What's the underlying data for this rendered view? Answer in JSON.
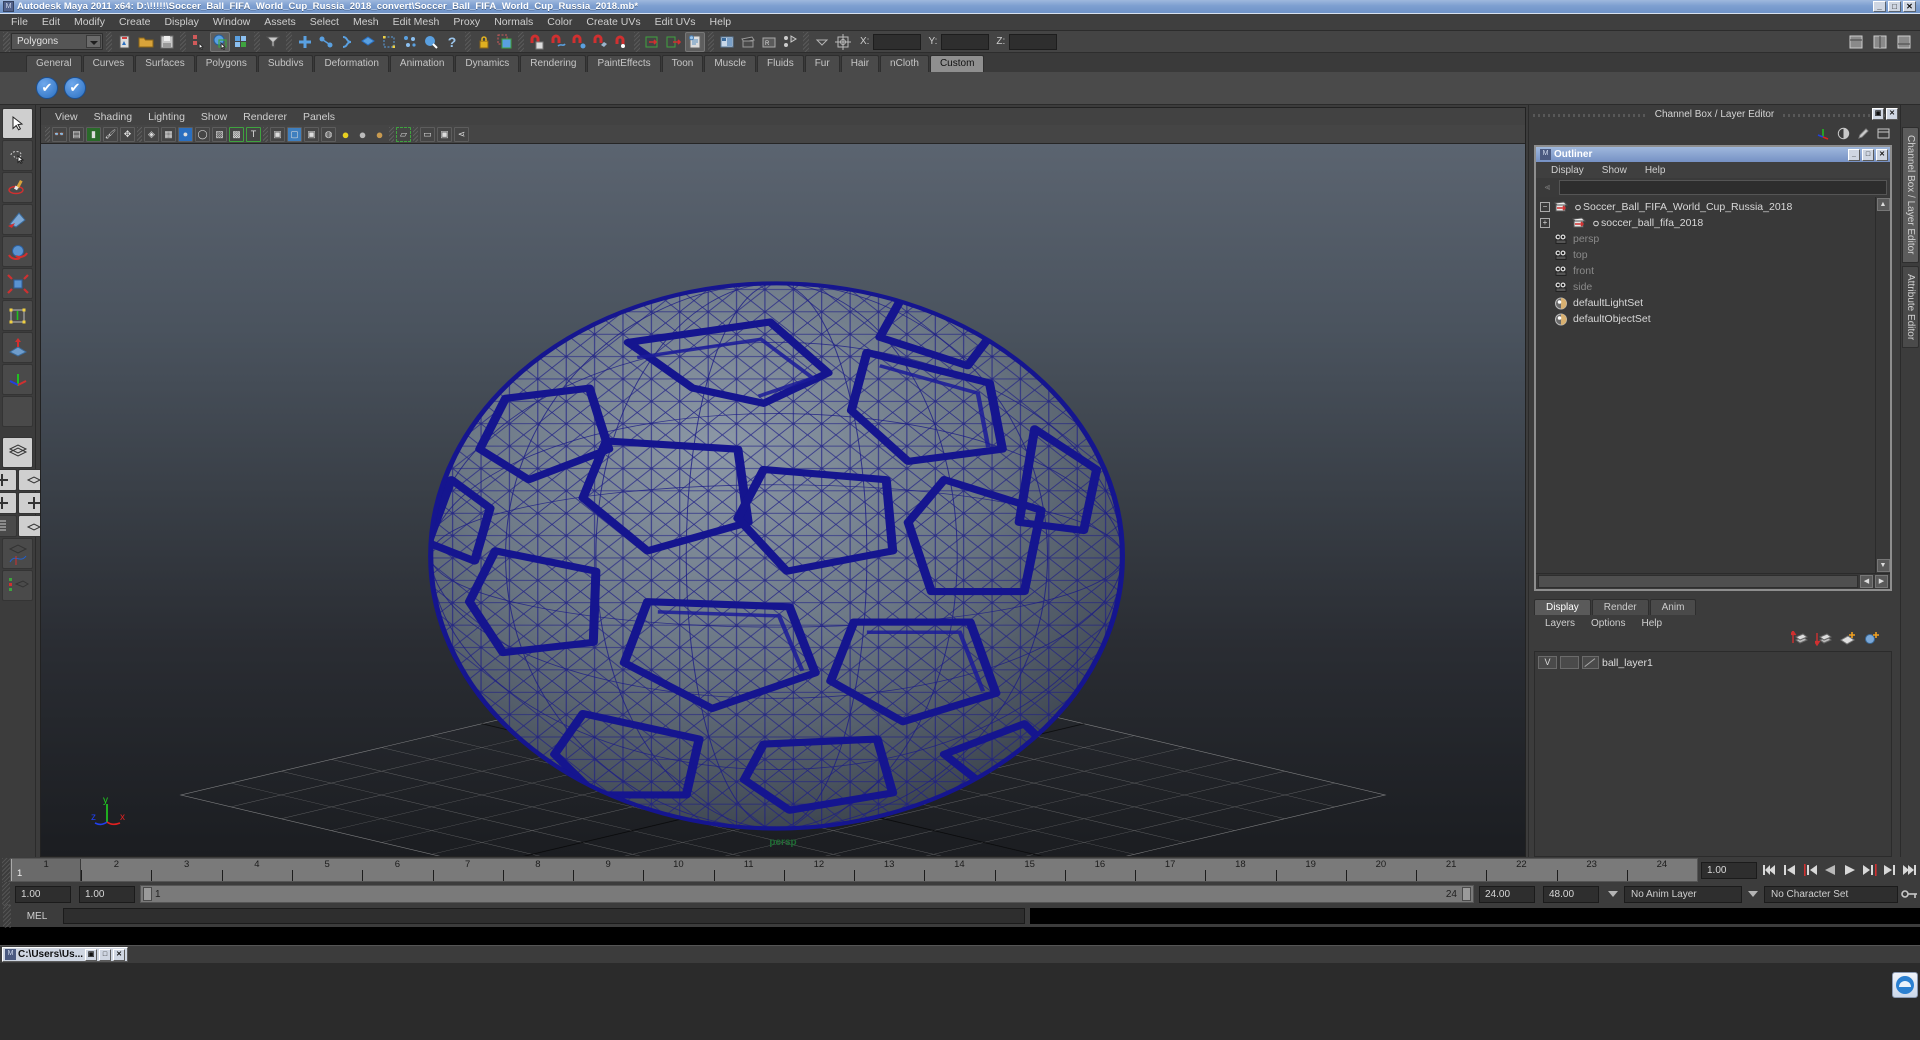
{
  "window": {
    "title": "Autodesk Maya 2011 x64: D:\\!!!!!\\Soccer_Ball_FIFA_World_Cup_Russia_2018_convert\\Soccer_Ball_FIFA_World_Cup_Russia_2018.mb*",
    "app_icon": "maya-icon",
    "minimize": "_",
    "maximize": "□",
    "close": "✕",
    "accent_titlebar": "#7d9fd0"
  },
  "menubar": {
    "items": [
      "File",
      "Edit",
      "Modify",
      "Create",
      "Display",
      "Window",
      "Assets",
      "Select",
      "Mesh",
      "Edit Mesh",
      "Proxy",
      "Normals",
      "Color",
      "Create UVs",
      "Edit UVs",
      "Help"
    ]
  },
  "toolbar": {
    "mode_selector": "Polygons",
    "coords": {
      "x_label": "X:",
      "y_label": "Y:",
      "z_label": "Z:",
      "x_value": "",
      "y_value": "",
      "z_value": ""
    },
    "icons": [
      "new-scene-icon",
      "open-scene-icon",
      "save-scene-icon",
      "select-by-hierarchy-icon",
      "select-by-object-icon",
      "select-by-component-icon",
      "selection-mask-icon",
      "snap-grid-icon",
      "snap-curve-icon",
      "snap-point-icon",
      "snap-view-plane-icon",
      "snap-live-icon",
      "magnet-grid-icon",
      "magnet-curve-icon",
      "magnet-point-icon",
      "magnet-plane-icon",
      "magnet-live-icon",
      "render-current-frame-icon",
      "ipr-render-icon",
      "render-settings-icon",
      "hypershade-icon",
      "render-view-icon",
      "render-globals-icon",
      "hypergraph-icon",
      "lock-icon",
      "highlight-selection-icon",
      "show-manipulator-icon"
    ]
  },
  "shelf": {
    "tabs": [
      "General",
      "Curves",
      "Surfaces",
      "Polygons",
      "Subdivs",
      "Deformation",
      "Animation",
      "Dynamics",
      "Rendering",
      "PaintEffects",
      "Toon",
      "Muscle",
      "Fluids",
      "Fur",
      "Hair",
      "nCloth",
      "Custom"
    ],
    "active_tab": "Custom",
    "buttons": [
      "check-button-1",
      "check-button-2"
    ]
  },
  "toolbox": {
    "tools": [
      {
        "name": "select-tool",
        "glyph": "➤",
        "selected": true
      },
      {
        "name": "lasso-select-tool",
        "glyph": "◌"
      },
      {
        "name": "paint-select-tool",
        "glyph": "🖌"
      },
      {
        "name": "move-tool",
        "glyph": "◤"
      },
      {
        "name": "rotate-tool",
        "glyph": "◍"
      },
      {
        "name": "scale-tool",
        "glyph": "✥"
      },
      {
        "name": "universal-manipulator-tool",
        "glyph": "▣"
      },
      {
        "name": "soft-modification-tool",
        "glyph": "▲"
      },
      {
        "name": "show-manipulator-tool",
        "glyph": "✛"
      },
      {
        "name": "last-tool-used",
        "glyph": ""
      }
    ],
    "layouts": [
      "single-perspective-view",
      "four-view-layout",
      "persp-outliner-layout",
      "persp-graph-editor-layout",
      "persp-hypershade-layout"
    ]
  },
  "viewport": {
    "menus": [
      "View",
      "Shading",
      "Lighting",
      "Show",
      "Renderer",
      "Panels"
    ],
    "camera_label": "persp",
    "axis": {
      "x": "x",
      "y": "y",
      "z": "z",
      "x_color": "#e02020",
      "y_color": "#20d020",
      "z_color": "#2040f0"
    },
    "wireframe_color": "#1f1f8f",
    "shaded_color": "#68737f",
    "toolbar_icons": [
      "select-camera-icon",
      "camera-attributes-icon",
      "image-plane-icon",
      "paint-effects-icon",
      "2d-pan-zoom-icon",
      "wireframe-icon",
      "smooth-shade-icon",
      "hardware-texture-icon",
      "use-default-lighting-icon",
      "xray-icon",
      "xray-joints-icon",
      "show-textures-icon",
      "grid-toggle-icon",
      "film-gate-icon",
      "resolution-gate-icon",
      "gate-mask-icon",
      "light-icon-yellow",
      "light-icon-grey",
      "light-icon-tan",
      "selection-highlight-icon",
      "isolate-select-icon",
      "single-pane-icon",
      "multi-pane-icon",
      "share-icon"
    ]
  },
  "channel_box_header": {
    "title": "Channel Box / Layer Editor",
    "icons": [
      "axis-icon",
      "contrast-icon",
      "pencil-icon",
      "attributes-icon"
    ],
    "window_buttons": [
      "restore",
      "close"
    ]
  },
  "outliner": {
    "title": "Outliner",
    "icon": "maya-icon",
    "window_buttons": [
      "_",
      "□",
      "✕"
    ],
    "menus": [
      "Display",
      "Show",
      "Help"
    ],
    "search_value": "",
    "search_placeholder": "",
    "rows": [
      {
        "label": "Soccer_Ball_FIFA_World_Cup_Russia_2018",
        "icon": "transform-node-icon",
        "expander": "−",
        "indent": 0,
        "dim": false
      },
      {
        "label": "soccer_ball_fifa_2018",
        "icon": "transform-node-icon",
        "expander": "+",
        "indent": 1,
        "dim": false
      },
      {
        "label": "persp",
        "icon": "camera-icon",
        "expander": "",
        "indent": 0,
        "dim": true
      },
      {
        "label": "top",
        "icon": "camera-icon",
        "expander": "",
        "indent": 0,
        "dim": true
      },
      {
        "label": "front",
        "icon": "camera-icon",
        "expander": "",
        "indent": 0,
        "dim": true
      },
      {
        "label": "side",
        "icon": "camera-icon",
        "expander": "",
        "indent": 0,
        "dim": true
      },
      {
        "label": "defaultLightSet",
        "icon": "set-icon",
        "expander": "",
        "indent": 0,
        "dim": false
      },
      {
        "label": "defaultObjectSet",
        "icon": "set-icon",
        "expander": "",
        "indent": 0,
        "dim": false
      }
    ]
  },
  "layer_editor": {
    "tabs": [
      "Display",
      "Render",
      "Anim"
    ],
    "active_tab": "Display",
    "menus": [
      "Layers",
      "Options",
      "Help"
    ],
    "icons": [
      "move-layer-up-icon",
      "move-layer-down-icon",
      "new-layer-icon",
      "new-layer-from-selected-icon"
    ],
    "layers": [
      {
        "visibility": "V",
        "playback": "",
        "color_swatch": "",
        "name": "ball_layer1"
      }
    ]
  },
  "right_tabs": [
    {
      "label": "Channel Box / Layer Editor",
      "active": true
    },
    {
      "label": "Attribute Editor",
      "active": false
    }
  ],
  "timeline": {
    "start_tick": 1,
    "end_tick": 24,
    "ticks": [
      1,
      2,
      3,
      4,
      5,
      6,
      7,
      8,
      9,
      10,
      11,
      12,
      13,
      14,
      15,
      16,
      17,
      18,
      19,
      20,
      21,
      22,
      23,
      24
    ],
    "current_frame_label": "1",
    "current_time_field": "1.00",
    "playback_buttons": [
      "go-to-start-icon",
      "step-back-frame-icon",
      "step-back-key-icon",
      "play-backwards-icon",
      "play-forwards-icon",
      "step-forward-key-icon",
      "step-forward-frame-icon",
      "go-to-end-icon"
    ]
  },
  "range_slider": {
    "anim_start": "1.00",
    "range_start": "1.00",
    "range_bar_start": "1",
    "range_bar_end": "24",
    "range_end": "24.00",
    "anim_end": "48.00",
    "anim_layer": "No Anim Layer",
    "character_set": "No Character Set",
    "key_icon": "key-icon"
  },
  "command_line": {
    "label": "MEL",
    "input_value": "",
    "input_placeholder": ""
  },
  "taskbar": {
    "items": [
      {
        "icon": "maya-icon",
        "label": "C:\\Users\\Us...",
        "buttons": [
          "▣",
          "□",
          "✕"
        ]
      }
    ]
  },
  "help_button": {
    "name": "help-bubble-icon"
  }
}
